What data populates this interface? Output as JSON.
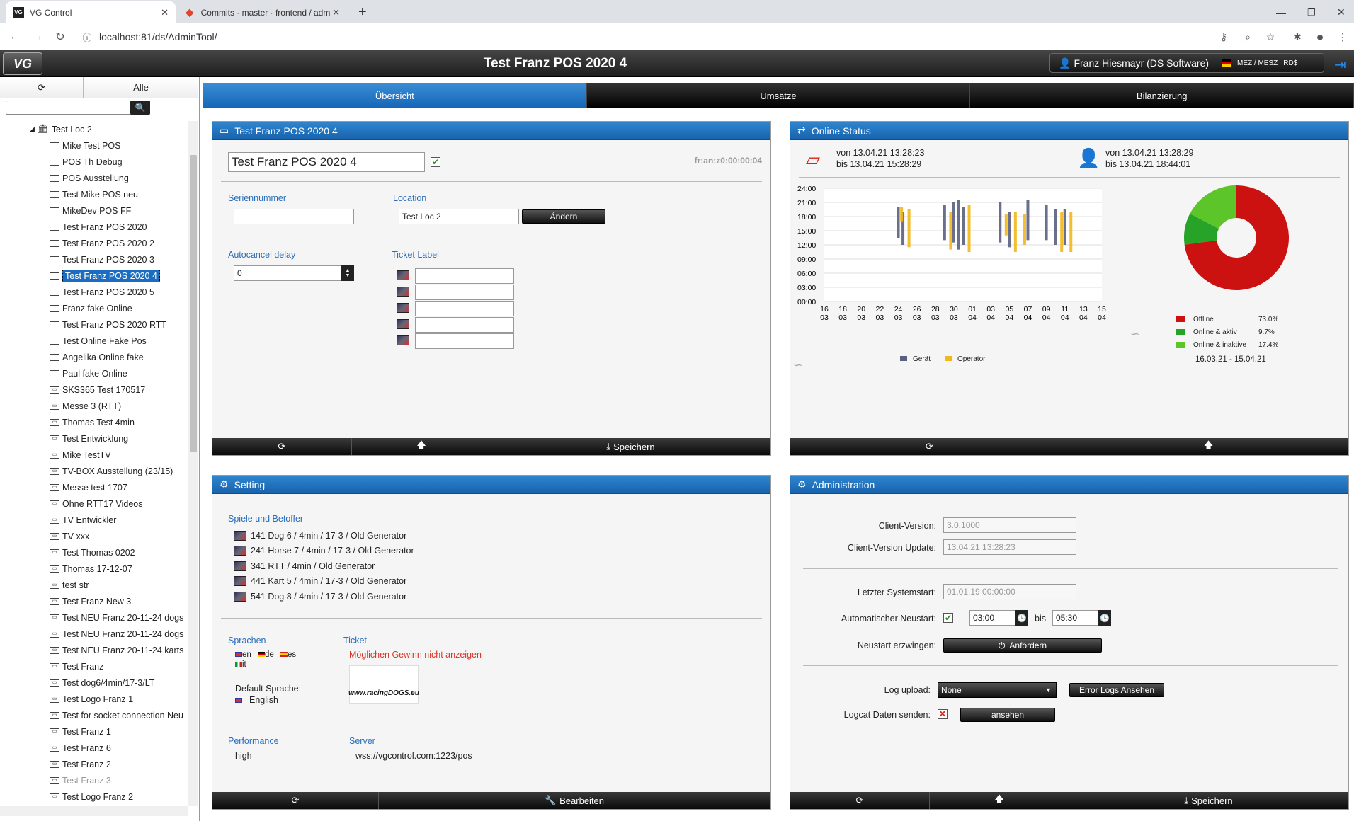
{
  "browser": {
    "tabs": [
      {
        "title": "VG Control",
        "favicon": "VG"
      },
      {
        "title": "Commits · master · frontend / adm",
        "favicon": "gitlab"
      }
    ],
    "url": "localhost:81/ds/AdminTool/"
  },
  "header": {
    "logo": "VG",
    "title": "Test Franz POS 2020 4",
    "user": "Franz Hiesmayr (DS Software)",
    "timezone": "MEZ / MESZ",
    "currency": "RD$"
  },
  "sidebar": {
    "filter_label": "Alle",
    "search_placeholder": "",
    "root": "Test Loc 2",
    "items": [
      {
        "label": "Mike Test POS",
        "type": "pos"
      },
      {
        "label": "POS Th Debug",
        "type": "pos"
      },
      {
        "label": "POS Ausstellung",
        "type": "pos"
      },
      {
        "label": "Test Mike POS neu",
        "type": "pos"
      },
      {
        "label": "MikeDev POS FF",
        "type": "pos"
      },
      {
        "label": "Test Franz POS 2020",
        "type": "pos"
      },
      {
        "label": "Test Franz POS 2020 2",
        "type": "pos"
      },
      {
        "label": "Test Franz POS 2020 3",
        "type": "pos"
      },
      {
        "label": "Test Franz POS 2020 4",
        "type": "pos",
        "selected": true
      },
      {
        "label": "Test Franz POS 2020 5",
        "type": "pos"
      },
      {
        "label": "Franz fake Online",
        "type": "pos"
      },
      {
        "label": "Test Franz POS 2020 RTT",
        "type": "pos"
      },
      {
        "label": "Test Online Fake Pos",
        "type": "pos"
      },
      {
        "label": "Angelika Online fake",
        "type": "pos"
      },
      {
        "label": "Paul fake Online",
        "type": "pos"
      },
      {
        "label": "SKS365 Test 170517",
        "type": "tv"
      },
      {
        "label": "Messe 3 (RTT)",
        "type": "tv"
      },
      {
        "label": "Thomas Test 4min",
        "type": "tv"
      },
      {
        "label": "Test Entwicklung",
        "type": "tv"
      },
      {
        "label": "Mike TestTV",
        "type": "tv"
      },
      {
        "label": "TV-BOX Ausstellung (23/15)",
        "type": "tv"
      },
      {
        "label": "Messe test 1707",
        "type": "tv"
      },
      {
        "label": "Ohne RTT17 Videos",
        "type": "tv"
      },
      {
        "label": "TV Entwickler",
        "type": "tv"
      },
      {
        "label": "TV xxx",
        "type": "tv"
      },
      {
        "label": "Test Thomas 0202",
        "type": "tv"
      },
      {
        "label": "Thomas 17-12-07",
        "type": "tv"
      },
      {
        "label": "test str",
        "type": "tv"
      },
      {
        "label": "Test Franz New 3",
        "type": "tv"
      },
      {
        "label": "Test NEU Franz 20-11-24 dogs",
        "type": "tv"
      },
      {
        "label": "Test NEU Franz 20-11-24 dogs",
        "type": "tv"
      },
      {
        "label": "Test NEU Franz 20-11-24 karts",
        "type": "tv"
      },
      {
        "label": "Test Franz",
        "type": "tv"
      },
      {
        "label": "Test dog6/4min/17-3/LT",
        "type": "tv"
      },
      {
        "label": "Test Logo Franz 1",
        "type": "tv"
      },
      {
        "label": "Test for socket connection Neu",
        "type": "tv"
      },
      {
        "label": "Test Franz 1",
        "type": "tv"
      },
      {
        "label": "Test Franz 6",
        "type": "tv"
      },
      {
        "label": "Test Franz 2",
        "type": "tv"
      },
      {
        "label": "Test Franz 3",
        "type": "tv",
        "dim": true
      },
      {
        "label": "Test Logo Franz 2",
        "type": "tv"
      }
    ]
  },
  "main_tabs": [
    "Übersicht",
    "Umsätze",
    "Bilanzierung"
  ],
  "pos_panel": {
    "title": "Test Franz POS 2020 4",
    "name_value": "Test Franz POS 2020 4",
    "mac": "fr:an:z0:00:00:04",
    "serial_label": "Seriennummer",
    "serial_value": "",
    "location_label": "Location",
    "location_value": "Test Loc 2",
    "change_button": "Ändern",
    "autocancel_label": "Autocancel delay",
    "autocancel_value": "0",
    "ticket_label": "Ticket Label",
    "ticket_values": [
      "",
      "",
      "",
      "",
      ""
    ],
    "footer": {
      "save": "Speichern"
    }
  },
  "online_status": {
    "title": "Online Status",
    "device_from": "von 13.04.21 13:28:23",
    "device_to": "bis  13.04.21 15:28:29",
    "user_from": "von 13.04.21 13:28:29",
    "user_to": "bis  13.04.21 18:44:01",
    "legend": [
      "Gerät",
      "Operator"
    ],
    "pie_legend": [
      {
        "label": "Offline",
        "pct": "73.0%"
      },
      {
        "label": "Online & aktiv",
        "pct": "9.7%"
      },
      {
        "label": "Online & inaktive",
        "pct": "17.4%"
      }
    ],
    "date_range": "16.03.21  -  15.04.21"
  },
  "chart_data": [
    {
      "type": "bar",
      "title": "",
      "y_ticks": [
        "24:00",
        "21:00",
        "18:00",
        "15:00",
        "12:00",
        "09:00",
        "06:00",
        "03:00",
        "00:00"
      ],
      "x_ticks": [
        "16 03",
        "18 03",
        "20 03",
        "22 03",
        "24 03",
        "26 03",
        "28 03",
        "30 03",
        "01 04",
        "03 04",
        "05 04",
        "07 04",
        "09 04",
        "11 04",
        "13 04",
        "15 04"
      ],
      "series": [
        {
          "name": "Gerät",
          "color": "#5a6080",
          "ranges": [
            [
              24,
              13.5,
              20
            ],
            [
              24.5,
              12,
              19
            ],
            [
              29,
              13,
              20.5
            ],
            [
              30,
              12.5,
              21
            ],
            [
              30.5,
              11,
              21.5
            ],
            [
              31,
              12,
              20
            ],
            [
              35,
              12.5,
              21
            ],
            [
              36,
              11.5,
              19
            ],
            [
              38,
              13,
              21.5
            ],
            [
              40,
              13,
              20.5
            ],
            [
              41,
              12,
              19.5
            ],
            [
              42,
              12,
              19.5
            ]
          ]
        },
        {
          "name": "Operator",
          "color": "#f2b818",
          "ranges": [
            [
              24.2,
              17,
              20
            ],
            [
              25,
              11.5,
              19.5
            ],
            [
              29.5,
              11,
              19
            ],
            [
              31.5,
              10.5,
              20.5
            ],
            [
              35.5,
              14,
              18.5
            ],
            [
              36.5,
              10.5,
              19
            ],
            [
              37.5,
              12,
              18.5
            ],
            [
              41.5,
              10.5,
              19
            ],
            [
              42.5,
              10.5,
              19
            ]
          ]
        }
      ],
      "ylim": [
        0,
        24
      ]
    },
    {
      "type": "pie",
      "title": "",
      "categories": [
        "Offline",
        "Online & aktiv",
        "Online & inaktive"
      ],
      "values": [
        73.0,
        9.7,
        17.4
      ],
      "colors": [
        "#cc1111",
        "#27a327",
        "#5bc52a"
      ]
    }
  ],
  "setting": {
    "title": "Setting",
    "games_label": "Spiele und Betoffer",
    "games": [
      "141 Dog 6 / 4min / 17-3 / Old Generator",
      "241 Horse 7 / 4min / 17-3 / Old Generator",
      "341 RTT / 4min / Old Generator",
      "441 Kart 5 / 4min / 17-3 / Old Generator",
      "541 Dog 8 / 4min / 17-3 / Old Generator"
    ],
    "languages_label": "Sprachen",
    "languages": [
      "en",
      "de",
      "es",
      "it"
    ],
    "ticket_label": "Ticket",
    "ticket_warning": "Möglichen Gewinn nicht anzeigen",
    "ticket_logo": "www.racingDOGS.eu",
    "default_lang_label": "Default Sprache:",
    "default_lang": "English",
    "performance_label": "Performance",
    "performance_value": "high",
    "server_label": "Server",
    "server_value": "wss://vgcontrol.com:1223/pos",
    "footer": {
      "edit": "Bearbeiten"
    }
  },
  "admin": {
    "title": "Administration",
    "client_version_label": "Client-Version:",
    "client_version": "3.0.1000",
    "client_update_label": "Client-Version Update:",
    "client_update": "13.04.21 13:28:23",
    "last_start_label": "Letzter Systemstart:",
    "last_start": "01.01.19 00:00:00",
    "auto_restart_label": "Automatischer Neustart:",
    "restart_from": "03:00",
    "restart_bis": "bis",
    "restart_to": "05:30",
    "force_restart_label": "Neustart erzwingen:",
    "force_restart_button": "Anfordern",
    "log_upload_label": "Log upload:",
    "log_upload_value": "None",
    "error_logs_button": "Error Logs Ansehen",
    "logcat_label": "Logcat Daten senden:",
    "logcat_button": "ansehen",
    "footer": {
      "save": "Speichern"
    }
  }
}
